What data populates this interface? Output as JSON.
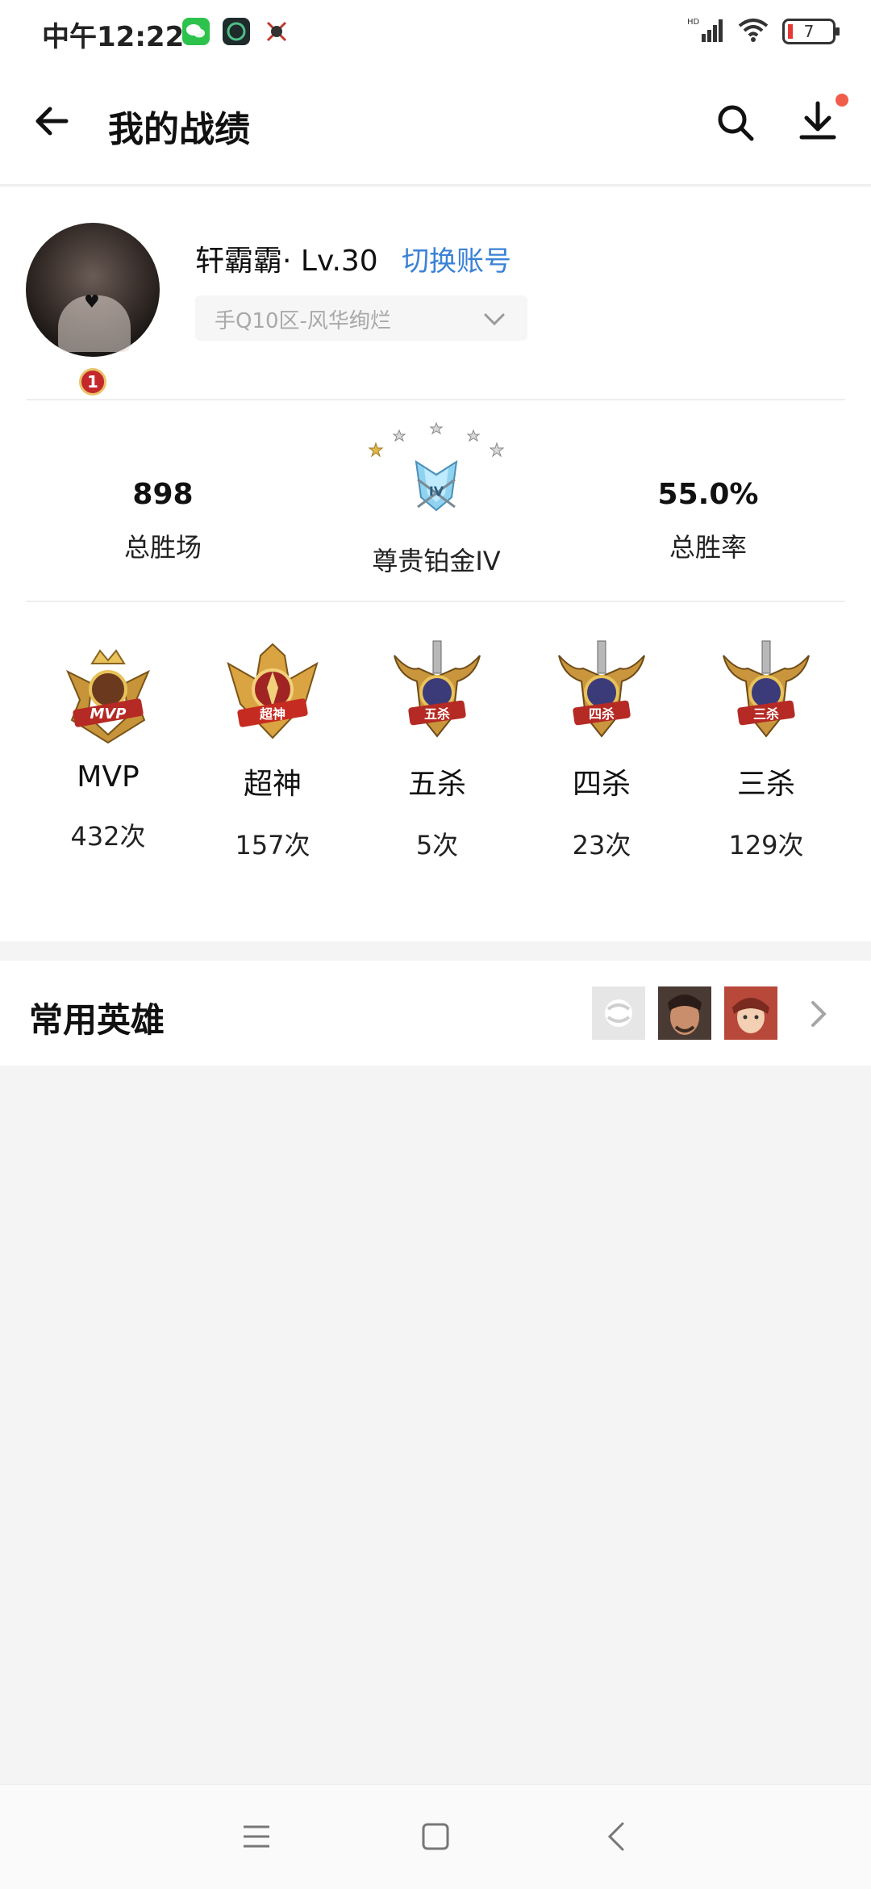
{
  "status_bar": {
    "time": "中午12:22",
    "network": "HD",
    "battery_level": "7"
  },
  "header": {
    "title": "我的战绩"
  },
  "profile": {
    "name": "轩霸霸· Lv.30",
    "switch_account": "切换账号",
    "server": "手Q10区-风华绚烂",
    "avatar_rank": "1"
  },
  "summary": {
    "total_wins_value": "898",
    "total_wins_label": "总胜场",
    "rank_tier": "尊贵铂金IV",
    "rank_emblem_text": "IV",
    "win_rate_value": "55.0%",
    "win_rate_label": "总胜率",
    "stars_earned": 1,
    "stars_total": 5
  },
  "medals": [
    {
      "name": "MVP",
      "count": "432次",
      "badge": "MVP"
    },
    {
      "name": "超神",
      "count": "157次",
      "badge": "超神"
    },
    {
      "name": "五杀",
      "count": "5次",
      "badge": "五杀"
    },
    {
      "name": "四杀",
      "count": "23次",
      "badge": "四杀"
    },
    {
      "name": "三杀",
      "count": "129次",
      "badge": "三杀"
    }
  ],
  "heroes": {
    "title": "常用英雄"
  },
  "colors": {
    "accent": "#3a82d6",
    "notification": "#f25c4a",
    "background": "#f4f4f4"
  }
}
